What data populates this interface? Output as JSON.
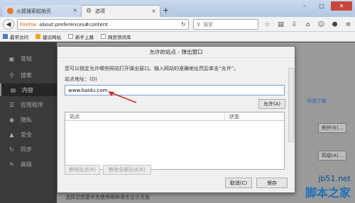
{
  "tabs": [
    {
      "label": "火狐搜索起始页"
    },
    {
      "label": "选项"
    }
  ],
  "nav": {
    "browser_label": "Firefox",
    "url": "about:preferences#content",
    "search_placeholder": "搜索"
  },
  "bookmarks": [
    {
      "label": "最常访问"
    },
    {
      "label": "建议网站"
    },
    {
      "label": "新手上路"
    },
    {
      "label": "网页快讯库"
    }
  ],
  "sidebar": {
    "items": [
      {
        "label": "常规"
      },
      {
        "label": "搜索"
      },
      {
        "label": "内容"
      },
      {
        "label": "应用程序"
      },
      {
        "label": "隐私"
      },
      {
        "label": "安全"
      },
      {
        "label": "同步"
      },
      {
        "label": "高级"
      }
    ]
  },
  "background": {
    "link": "详细了解",
    "buttons": [
      "例外(E)...",
      "高级(A)..."
    ],
    "bottom_text": "选择您想要优先使用哪种语言显示页面"
  },
  "dialog": {
    "title": "允许的站点 - 弹出窗口",
    "description": "您可以指定允许哪些网站打开弹出窗口。输入网站的准确地址然后单击“允许”。",
    "site_label": "站点地址：(D)",
    "site_value": "www.baidu.com",
    "allow_label": "允许(A)",
    "columns": [
      "站点",
      "状态"
    ],
    "remove_label": "移除站点(R)",
    "remove_all_label": "移除全部站点(E)",
    "cancel_label": "取消(C)",
    "save_label": "保存"
  },
  "watermark": {
    "line1": "jb51.net",
    "line2": "脚本之家"
  },
  "colors": {
    "arrow": "#d42a2a",
    "link": "#3366aa"
  }
}
